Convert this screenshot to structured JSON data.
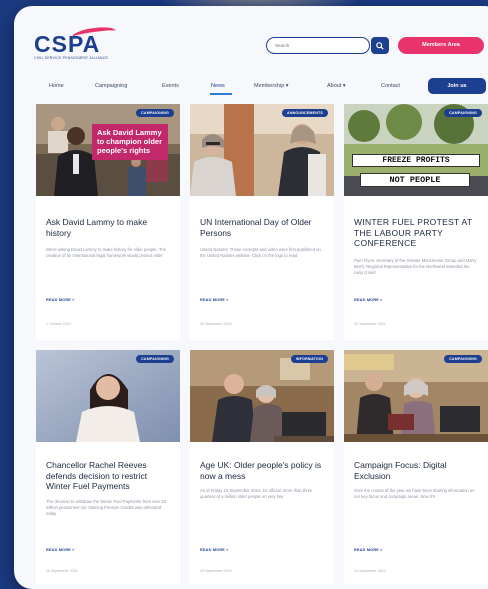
{
  "header": {
    "logo_text": "CSPA",
    "tagline": "CIVIL SERVICE PENSIONERS' ALLIANCE",
    "search_placeholder": "Search",
    "members_label": "Members Area",
    "join_label": "Join us"
  },
  "nav": [
    {
      "label": "Home"
    },
    {
      "label": "Campaigning"
    },
    {
      "label": "Events"
    },
    {
      "label": "News"
    },
    {
      "label": "Membership ▾"
    },
    {
      "label": "About ▾"
    },
    {
      "label": "Contact"
    }
  ],
  "cards": [
    {
      "badge": "CAMPAIGNING",
      "overlay": "Ask David Lammy to champion older people's rights",
      "title": "Ask David Lammy to make history",
      "excerpt": "We're asking David Lammy to make history for older people. The creation of an international legal framework would protect older",
      "read_more": "READ MORE »",
      "date": "1 October 2024"
    },
    {
      "badge": "ANNOUNCEMENTS",
      "title": "UN International Day of Older Persons",
      "excerpt": "United Nations: These excerpts and video were first published on the United Nations website. Click on the logo to read",
      "read_more": "READ MORE »",
      "date": "30 September 2024"
    },
    {
      "badge": "CAMPAIGNING",
      "sign_top": "FREEZE  PROFITS",
      "sign_bottom": "NOT PEOPLE",
      "title": "WINTER FUEL PROTEST AT THE LABOUR PARTY CONFERENCE",
      "excerpt": "Pam Flynn, secretary of the Greater Manchester Group and Marry Beeh, Regional Representative for the Northwest attended the rainy crowd",
      "read_more": "READ MORE »",
      "date": "30 September 2024"
    },
    {
      "badge": "CAMPAIGNING",
      "title": "Chancellor Rachel Reeves defends decision to restrict Winter Fuel Payments",
      "excerpt": "The decision to withdraw the Winter Fuel Payments from over 10 million pensioners not claiming Pension Credits was defended today",
      "read_more": "READ MORE »",
      "date": "26 September 2024"
    },
    {
      "badge": "INFORMATION",
      "title": "Age UK: Older people's policy is now a mess",
      "excerpt": "As of Friday 13 September 2024, it's official: more than three quarters of a million older people on very low",
      "read_more": "READ MORE »",
      "date": "25 September 2024"
    },
    {
      "badge": "CAMPAIGNING",
      "title": "Campaign Focus: Digital Exclusion",
      "excerpt": "Over the course of the year we have been sharing information on our key focus and campaign areas. Now it's",
      "read_more": "READ MORE »",
      "date": "24 September 2024"
    }
  ],
  "colors": {
    "brand_blue": "#1d3f8f",
    "brand_pink": "#e8336d",
    "page_bg": "#1b3a82"
  }
}
